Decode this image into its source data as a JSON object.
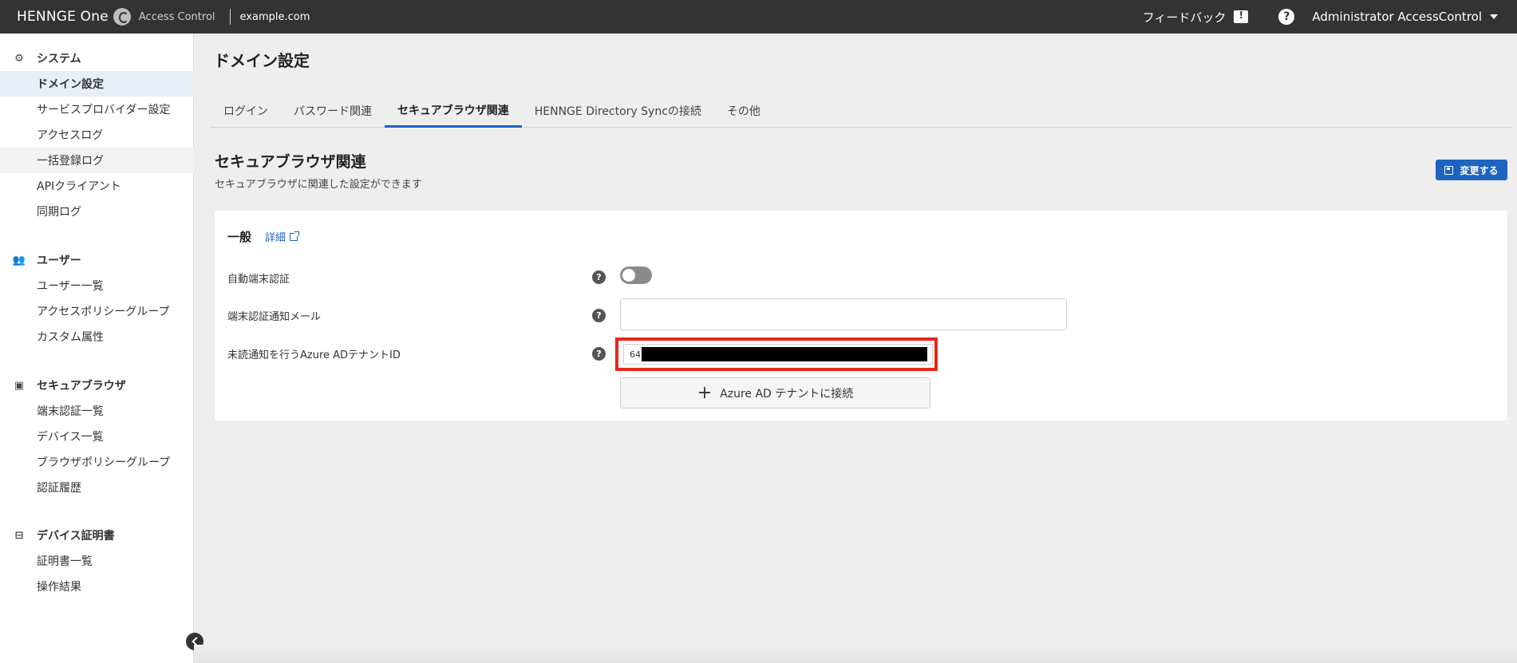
{
  "topbar": {
    "brand": "HENNGE One",
    "product": "Access Control",
    "domain": "example.com",
    "feedback_label": "フィードバック",
    "help_symbol": "?",
    "user_name": "Administrator AccessControl"
  },
  "sidebar": {
    "sections": [
      {
        "header": "システム",
        "icon": "gear-icon",
        "items": [
          {
            "label": "ドメイン設定",
            "state": "active"
          },
          {
            "label": "サービスプロバイダー設定",
            "state": ""
          },
          {
            "label": "アクセスログ",
            "state": ""
          },
          {
            "label": "一括登録ログ",
            "state": "hover"
          },
          {
            "label": "APIクライアント",
            "state": ""
          },
          {
            "label": "同期ログ",
            "state": ""
          }
        ]
      },
      {
        "header": "ユーザー",
        "icon": "users-icon",
        "items": [
          {
            "label": "ユーザー一覧"
          },
          {
            "label": "アクセスポリシーグループ"
          },
          {
            "label": "カスタム属性"
          }
        ]
      },
      {
        "header": "セキュアブラウザ",
        "icon": "browser-icon",
        "items": [
          {
            "label": "端末認証一覧"
          },
          {
            "label": "デバイス一覧"
          },
          {
            "label": "ブラウザポリシーグループ"
          },
          {
            "label": "認証履歴"
          }
        ]
      },
      {
        "header": "デバイス証明書",
        "icon": "certificate-icon",
        "items": [
          {
            "label": "証明書一覧"
          },
          {
            "label": "操作結果"
          }
        ]
      }
    ]
  },
  "page": {
    "title": "ドメイン設定",
    "tabs": [
      {
        "label": "ログイン",
        "active": false
      },
      {
        "label": "パスワード関連",
        "active": false
      },
      {
        "label": "セキュアブラウザ関連",
        "active": true
      },
      {
        "label": "HENNGE Directory Syncの接続",
        "active": false
      },
      {
        "label": "その他",
        "active": false
      }
    ]
  },
  "section": {
    "title": "セキュアブラウザ関連",
    "description": "セキュアブラウザに関連した設定ができます",
    "change_button": "変更する"
  },
  "card": {
    "title": "一般",
    "detail_link": "詳細",
    "rows": {
      "auto_auth": {
        "label": "自動端末認証",
        "toggle_on": false
      },
      "notify_mail": {
        "label": "端末認証通知メール",
        "value": "",
        "placeholder": ""
      },
      "tenant_id": {
        "label": "未読通知を行うAzure ADテナントID",
        "value_prefix": "64"
      }
    },
    "connect_button": "Azure AD テナントに接続"
  },
  "colors": {
    "topbar_bg": "#333333",
    "accent": "#1d63c0",
    "highlight_border": "#e8261c",
    "active_nav_bg": "#e7eef6"
  }
}
